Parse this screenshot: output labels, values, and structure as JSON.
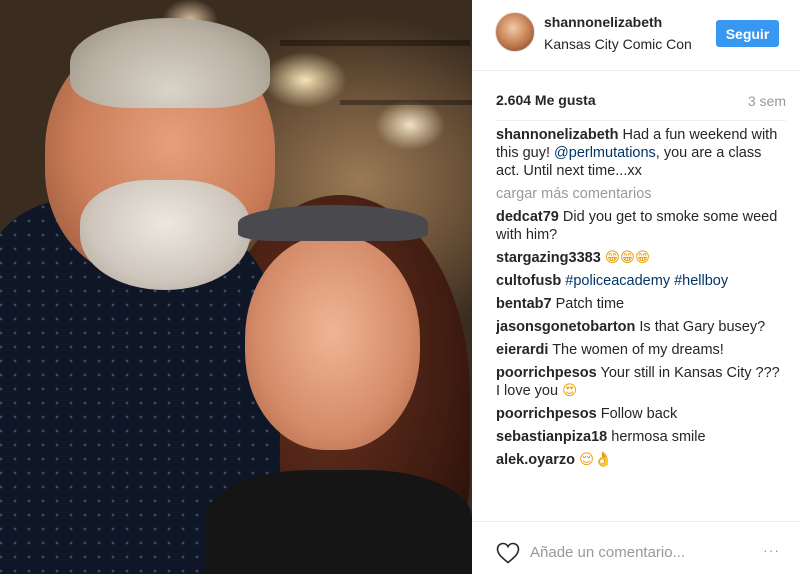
{
  "post": {
    "username": "shannonelizabeth",
    "location": "Kansas City Comic Con",
    "follow_label": "Seguir",
    "likes": "2.604 Me gusta",
    "time": "3 sem"
  },
  "caption": {
    "username": "shannonelizabeth",
    "text_before": " Had a fun weekend with this guy! ",
    "mention": "@perlmutations",
    "text_after": ", you are a class act. Until next time...xx"
  },
  "load_more": "cargar más comentarios",
  "comments": [
    {
      "username": "dedcat79",
      "text": "Did you get to smoke some weed with him?"
    },
    {
      "username": "stargazing3383",
      "emoji": "😁😁😁"
    },
    {
      "username": "cultofusb",
      "tags": "#policeacademy #hellboy"
    },
    {
      "username": "bentab7",
      "text": "Patch time"
    },
    {
      "username": "jasonsgonetobarton",
      "text": "Is that Gary busey?"
    },
    {
      "username": "eierardi",
      "text": "The women of my dreams!"
    },
    {
      "username": "poorrichpesos",
      "text": "Your still in Kansas City ??? I love you",
      "emoji": "😍"
    },
    {
      "username": "poorrichpesos",
      "text": "Follow back"
    },
    {
      "username": "sebastianpiza18",
      "text": "hermosa smile"
    },
    {
      "username": "alek.oyarzo",
      "emoji": "😌👌"
    }
  ],
  "footer": {
    "placeholder": "Añade un comentario...",
    "more": "···"
  },
  "icons": {
    "heart": "heart-icon",
    "more": "more-options-icon"
  },
  "colors": {
    "follow_button": "#3897f0",
    "link": "#003569",
    "muted": "#999999"
  }
}
